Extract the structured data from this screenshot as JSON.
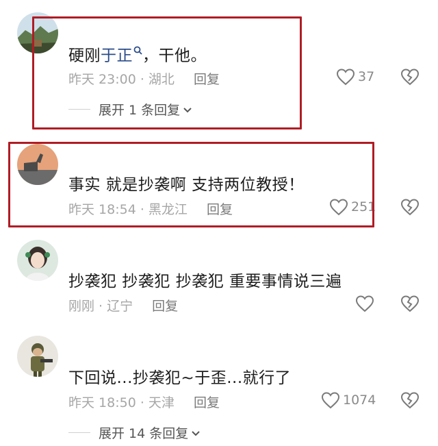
{
  "comments": [
    {
      "username": "",
      "text_before": "硬刚",
      "link_text": "于正",
      "text_after": "，干他。",
      "time": "昨天 23:00",
      "location": "湖北",
      "reply_label": "回复",
      "likes": "37",
      "expand_label": "展开 1 条回复"
    },
    {
      "username": "",
      "text": "事实 就是抄袭啊     支持两位教授！",
      "time": "昨天 18:54",
      "location": "黑龙江",
      "reply_label": "回复",
      "likes": "251"
    },
    {
      "username": "",
      "text": "抄袭犯 抄袭犯 抄袭犯 重要事情说三遍",
      "time": "刚刚",
      "location": "辽宁",
      "reply_label": "回复",
      "likes": ""
    },
    {
      "username": "",
      "text": "下回说...抄袭犯~于歪...就行了",
      "time": "昨天 18:50",
      "location": "天津",
      "reply_label": "回复",
      "likes": "1074",
      "expand_label": "展开 14 条回复"
    }
  ],
  "separator": " · ",
  "colors": {
    "highlight_border": "#b01c25",
    "link": "#2b4c8a",
    "meta": "#a6a6a6"
  },
  "icons": [
    "search-icon",
    "heart-icon",
    "broken-heart-icon",
    "chevron-down-icon"
  ]
}
